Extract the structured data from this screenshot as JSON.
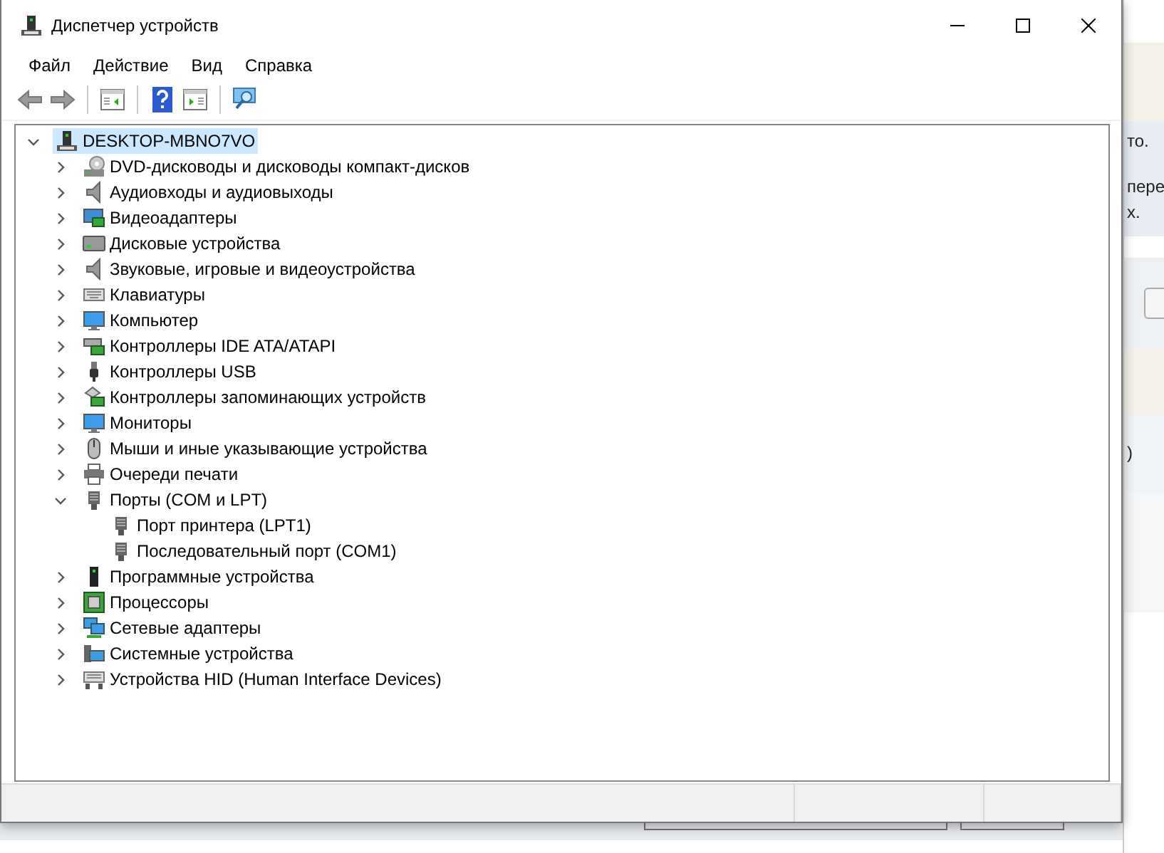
{
  "window": {
    "title": "Диспетчер устройств"
  },
  "menu": [
    "Файл",
    "Действие",
    "Вид",
    "Справка"
  ],
  "tree": [
    {
      "label": "DESKTOP-MBNO7VO",
      "selected": true,
      "expanded": true,
      "children": [
        {
          "label": "DVD-дисководы и дисководы компакт-дисков",
          "selected": false,
          "expanded": false
        },
        {
          "label": "Аудиовходы и аудиовыходы",
          "selected": false,
          "expanded": false
        },
        {
          "label": "Видеоадаптеры",
          "selected": false,
          "expanded": false
        },
        {
          "label": "Дисковые устройства",
          "selected": false,
          "expanded": false
        },
        {
          "label": "Звуковые, игровые и видеоустройства",
          "selected": false,
          "expanded": false
        },
        {
          "label": "Клавиатуры",
          "selected": false,
          "expanded": false
        },
        {
          "label": "Компьютер",
          "selected": false,
          "expanded": false
        },
        {
          "label": "Контроллеры IDE ATA/ATAPI",
          "selected": false,
          "expanded": false
        },
        {
          "label": "Контроллеры USB",
          "selected": false,
          "expanded": false
        },
        {
          "label": "Контроллеры запоминающих устройств",
          "selected": false,
          "expanded": false
        },
        {
          "label": "Мониторы",
          "selected": false,
          "expanded": false
        },
        {
          "label": "Мыши и иные указывающие устройства",
          "selected": false,
          "expanded": false
        },
        {
          "label": "Очереди печати",
          "selected": false,
          "expanded": false
        },
        {
          "label": "Порты (COM и LPT)",
          "selected": false,
          "expanded": true,
          "children": [
            {
              "label": "Порт принтера (LPT1)",
              "selected": false
            },
            {
              "label": "Последовательный порт (COM1)",
              "selected": false
            }
          ]
        },
        {
          "label": "Программные устройства",
          "selected": false,
          "expanded": false
        },
        {
          "label": "Процессоры",
          "selected": false,
          "expanded": false
        },
        {
          "label": "Сетевые адаптеры",
          "selected": false,
          "expanded": false
        },
        {
          "label": "Системные устройства",
          "selected": false,
          "expanded": false
        },
        {
          "label": "Устройства HID (Human Interface Devices)",
          "selected": false,
          "expanded": false
        }
      ]
    }
  ],
  "background_window": {
    "texts": [
      "то.",
      "пере",
      "х.",
      ")"
    ]
  }
}
